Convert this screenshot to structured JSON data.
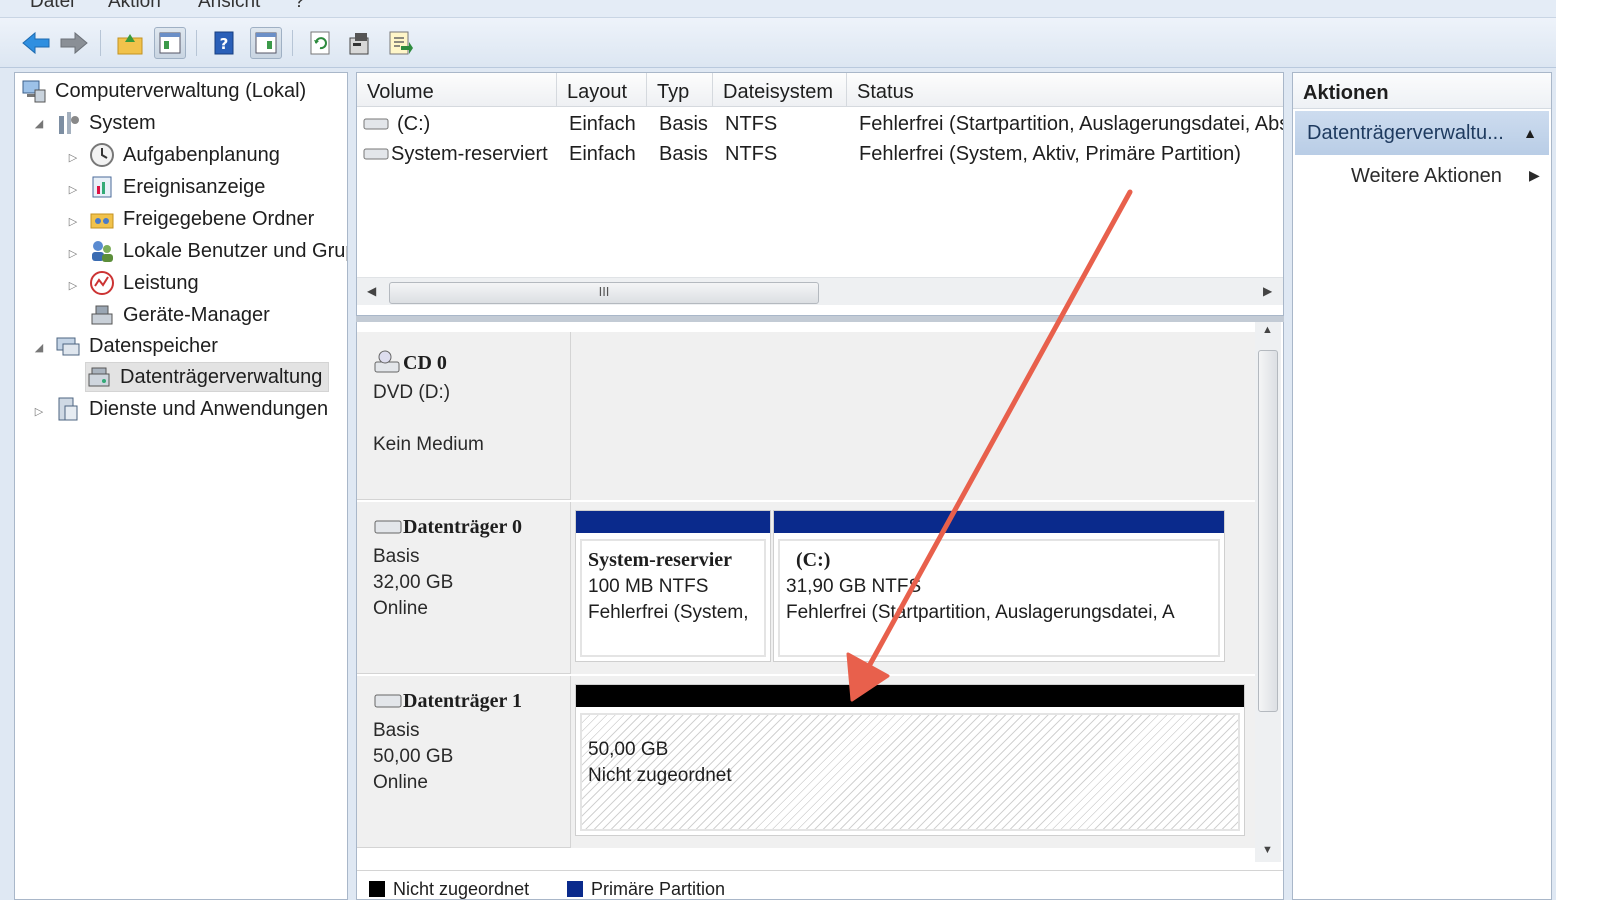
{
  "menu": {
    "items": [
      "Datei",
      "Aktion",
      "Ansicht",
      "?"
    ]
  },
  "toolbar": {
    "buttons": [
      "back-icon",
      "forward-icon",
      "up-folder-icon",
      "show-hide-console-tree-icon",
      "help-icon",
      "show-hide-action-pane-icon",
      "refresh-icon",
      "properties-icon",
      "export-list-icon"
    ]
  },
  "tree": {
    "root": "Computerverwaltung (Lokal)",
    "system": "System",
    "task_scheduler": "Aufgabenplanung",
    "event_viewer": "Ereignisanzeige",
    "shared_folders": "Freigegebene Ordner",
    "local_users": "Lokale Benutzer und Gruppen",
    "performance": "Leistung",
    "device_manager": "Geräte-Manager",
    "storage": "Datenspeicher",
    "disk_management": "Datenträgerverwaltung",
    "services": "Dienste und Anwendungen"
  },
  "volumes": {
    "columns": [
      "Volume",
      "Layout",
      "Typ",
      "Dateisystem",
      "Status"
    ],
    "rows": [
      [
        "(C:)",
        "Einfach",
        "Basis",
        "NTFS",
        "Fehlerfrei (Startpartition, Auslagerungsdatei, Absturzabbild, Primäre Partition)"
      ],
      [
        "System-reserviert",
        "Einfach",
        "Basis",
        "NTFS",
        "Fehlerfrei (System, Aktiv, Primäre Partition)"
      ]
    ],
    "scroll_grip": "III"
  },
  "disks": {
    "cd0": {
      "title": "CD 0",
      "line1": "DVD (D:)",
      "line2": "Kein Medium"
    },
    "disk0": {
      "title": "Datenträger 0",
      "type": "Basis",
      "size": "32,00 GB",
      "state": "Online",
      "partitions": [
        {
          "name": "System-reservier",
          "size": "100 MB NTFS",
          "status": "Fehlerfrei (System,",
          "color": "#0a2a8c"
        },
        {
          "name": "(C:)",
          "size": "31,90 GB NTFS",
          "status": "Fehlerfrei (Startpartition, Auslagerungsdatei, A",
          "color": "#0a2a8c"
        }
      ]
    },
    "disk1": {
      "title": "Datenträger 1",
      "type": "Basis",
      "size": "50,00 GB",
      "state": "Online",
      "partitions": [
        {
          "size": "50,00 GB",
          "status": "Nicht zugeordnet",
          "color": "#000000"
        }
      ]
    }
  },
  "legend": [
    {
      "label": "Nicht zugeordnet",
      "color": "#000000"
    },
    {
      "label": "Primäre Partition",
      "color": "#0a2a8c"
    }
  ],
  "actions": {
    "header": "Aktionen",
    "section": "Datenträgerverwaltu...",
    "more": "Weitere Aktionen"
  },
  "annotation": {
    "arrow_color": "#e8604c"
  }
}
